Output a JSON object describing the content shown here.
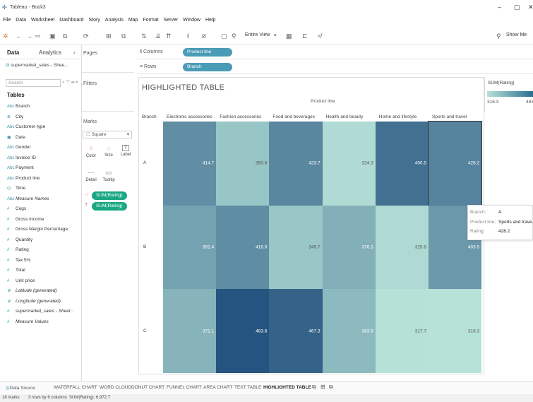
{
  "window": {
    "title": "Tableau - Book3",
    "controls": [
      "–",
      "▢",
      "✕"
    ]
  },
  "menu": [
    "File",
    "Data",
    "Worksheet",
    "Dashboard",
    "Story",
    "Analysis",
    "Map",
    "Format",
    "Server",
    "Window",
    "Help"
  ],
  "toolbar": {
    "fit_label": "Entire View",
    "show_me": "Show Me"
  },
  "sidebar": {
    "tab_data": "Data",
    "tab_analytics": "Analytics",
    "collapse": "‹",
    "datasource": "supermarket_sales - Shee...",
    "search_placeholder": "Search",
    "search_tools": "⌕ ▽ ☰ ▾",
    "tables_heading": "Tables",
    "dimensions": [
      {
        "icon": "Abc",
        "label": "Branch"
      },
      {
        "icon": "⊕",
        "label": "City"
      },
      {
        "icon": "Abc",
        "label": "Customer type"
      },
      {
        "icon": "▣",
        "label": "Date"
      },
      {
        "icon": "Abc",
        "label": "Gender"
      },
      {
        "icon": "Abc",
        "label": "Invoice ID"
      },
      {
        "icon": "Abc",
        "label": "Payment"
      },
      {
        "icon": "Abc",
        "label": "Product line"
      },
      {
        "icon": "◷",
        "label": "Time"
      },
      {
        "icon": "Abc",
        "label": "Measure Names"
      }
    ],
    "measures": [
      {
        "icon": "#",
        "label": "Cogs"
      },
      {
        "icon": "#",
        "label": "Gross Income"
      },
      {
        "icon": "#",
        "label": "Gross Margin Percentage"
      },
      {
        "icon": "#",
        "label": "Quantity"
      },
      {
        "icon": "#",
        "label": "Rating"
      },
      {
        "icon": "#",
        "label": "Tax 5%"
      },
      {
        "icon": "#",
        "label": "Total"
      },
      {
        "icon": "#",
        "label": "Unit price"
      },
      {
        "icon": "⊕",
        "label": "Latitude (generated)"
      },
      {
        "icon": "⊕",
        "label": "Longitude (generated)"
      },
      {
        "icon": "#",
        "label": "supermarket_sales - Sheet.."
      },
      {
        "icon": "#",
        "label": "Measure Values"
      }
    ]
  },
  "cards": {
    "pages": "Pages",
    "filters": "Filters",
    "marks": "Marks",
    "mark_type": "Square",
    "mark_type_caret": "▾",
    "buttons": [
      {
        "glyph": "⁘",
        "label": "Color"
      },
      {
        "glyph": "◌",
        "label": "Size"
      },
      {
        "glyph": "T",
        "label": "Label"
      },
      {
        "glyph": "⋯",
        "label": "Detail"
      },
      {
        "glyph": "▭",
        "label": "Tooltip"
      }
    ],
    "pills": [
      "SUM(Rating)",
      "SUM(Rating)"
    ]
  },
  "shelves": {
    "columns_label": "Columns",
    "columns_pill": "Product line",
    "rows_label": "Rows",
    "rows_pill": "Branch"
  },
  "sheet": {
    "title": "HIGHLIGHTED TABLE",
    "column_header": "Product line",
    "row_header": "Branch"
  },
  "chart_data": {
    "type": "heatmap",
    "title": "HIGHLIGHTED TABLE",
    "xlabel": "Product line",
    "ylabel": "Branch",
    "categories": [
      "Electronic accessories",
      "Fashion accessories",
      "Food and beverages",
      "Health and beauty",
      "Home and lifestyle",
      "Sports and travel"
    ],
    "rows": [
      "A",
      "B",
      "C"
    ],
    "values": [
      [
        414.7,
        350.8,
        423.7,
        324.3,
        450.5,
        428.2
      ],
      [
        391.4,
        416.8,
        349.7,
        376.3,
        325.8,
        403.5
      ],
      [
        371.1,
        483.6,
        467.3,
        363.9,
        317.7,
        316.3
      ]
    ],
    "value_labels": [
      [
        "414.7",
        "350.8",
        "423.7",
        "324.3",
        "450.5",
        "428.2"
      ],
      [
        "391.4",
        "416.8",
        "349.7",
        "376.3",
        "325.8",
        "403.5"
      ],
      [
        "371.1",
        "483.6",
        "467.3",
        "363.9",
        "317.7",
        "316.3"
      ]
    ],
    "color_scale": {
      "low": "#b6e2d8",
      "high": "#2a5f88"
    }
  },
  "legend": {
    "title": "SUM(Rating)",
    "min": "316.3",
    "max": "483"
  },
  "tooltip": {
    "k1": "Branch:",
    "v1": "A",
    "k2": "Product line:",
    "v2": "Sports and trave",
    "k3": "Rating:",
    "v3": "428.2"
  },
  "bottom_tabs": [
    "Data Source",
    "WATERFALL CHART",
    "WORD CLOUD",
    "DONUT CHART",
    "FUNNEL CHART",
    "AREA CHART",
    "TEXT TABLE",
    "HIGHLIGHTED TABLE"
  ],
  "bottom_icons": [
    "⧉",
    "⊞",
    "⧉"
  ],
  "data_source_icon": "◎",
  "status": {
    "marks": "18 marks",
    "dims": "3 rows by 6 columns",
    "sum": "SUM(Rating): 6,972.7"
  }
}
